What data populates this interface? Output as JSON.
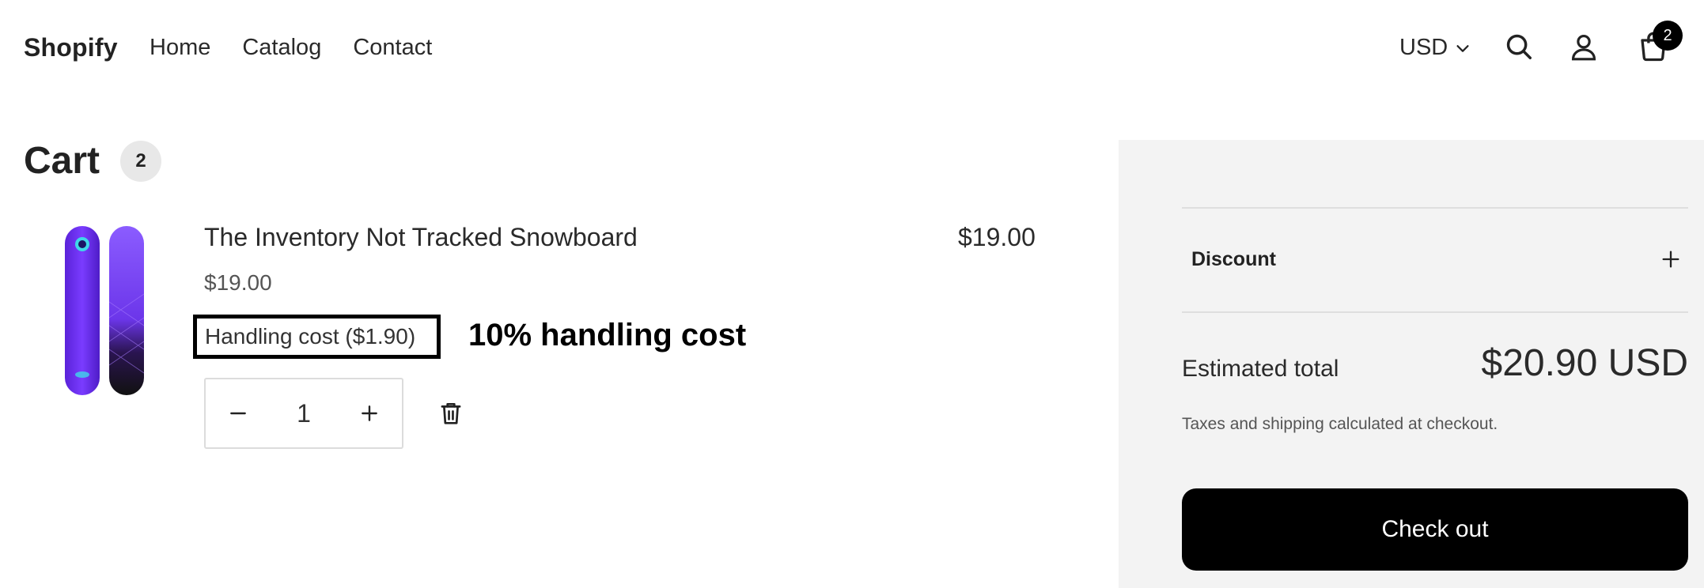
{
  "header": {
    "brand": "Shopify",
    "nav": [
      "Home",
      "Catalog",
      "Contact"
    ],
    "currency": "USD",
    "cart_count": "2"
  },
  "cart": {
    "title": "Cart",
    "count": "2",
    "items": [
      {
        "title": "The Inventory Not Tracked Snowboard",
        "unit_price": "$19.00",
        "line_total": "$19.00",
        "property": "Handling cost ($1.90)",
        "quantity": "1"
      }
    ],
    "annotation": "10% handling cost"
  },
  "summary": {
    "discount_label": "Discount",
    "estimated_total_label": "Estimated total",
    "estimated_total_value": "$20.90 USD",
    "tax_note": "Taxes and shipping calculated at checkout.",
    "checkout_label": "Check out"
  },
  "colors": {
    "accent": "#000000",
    "panel_bg": "#f3f3f3",
    "snowboard_purple": "#6a2cf0"
  },
  "icons": [
    "search-icon",
    "account-icon",
    "cart-icon",
    "chevron-down-icon",
    "minus-icon",
    "plus-icon",
    "trash-icon"
  ]
}
